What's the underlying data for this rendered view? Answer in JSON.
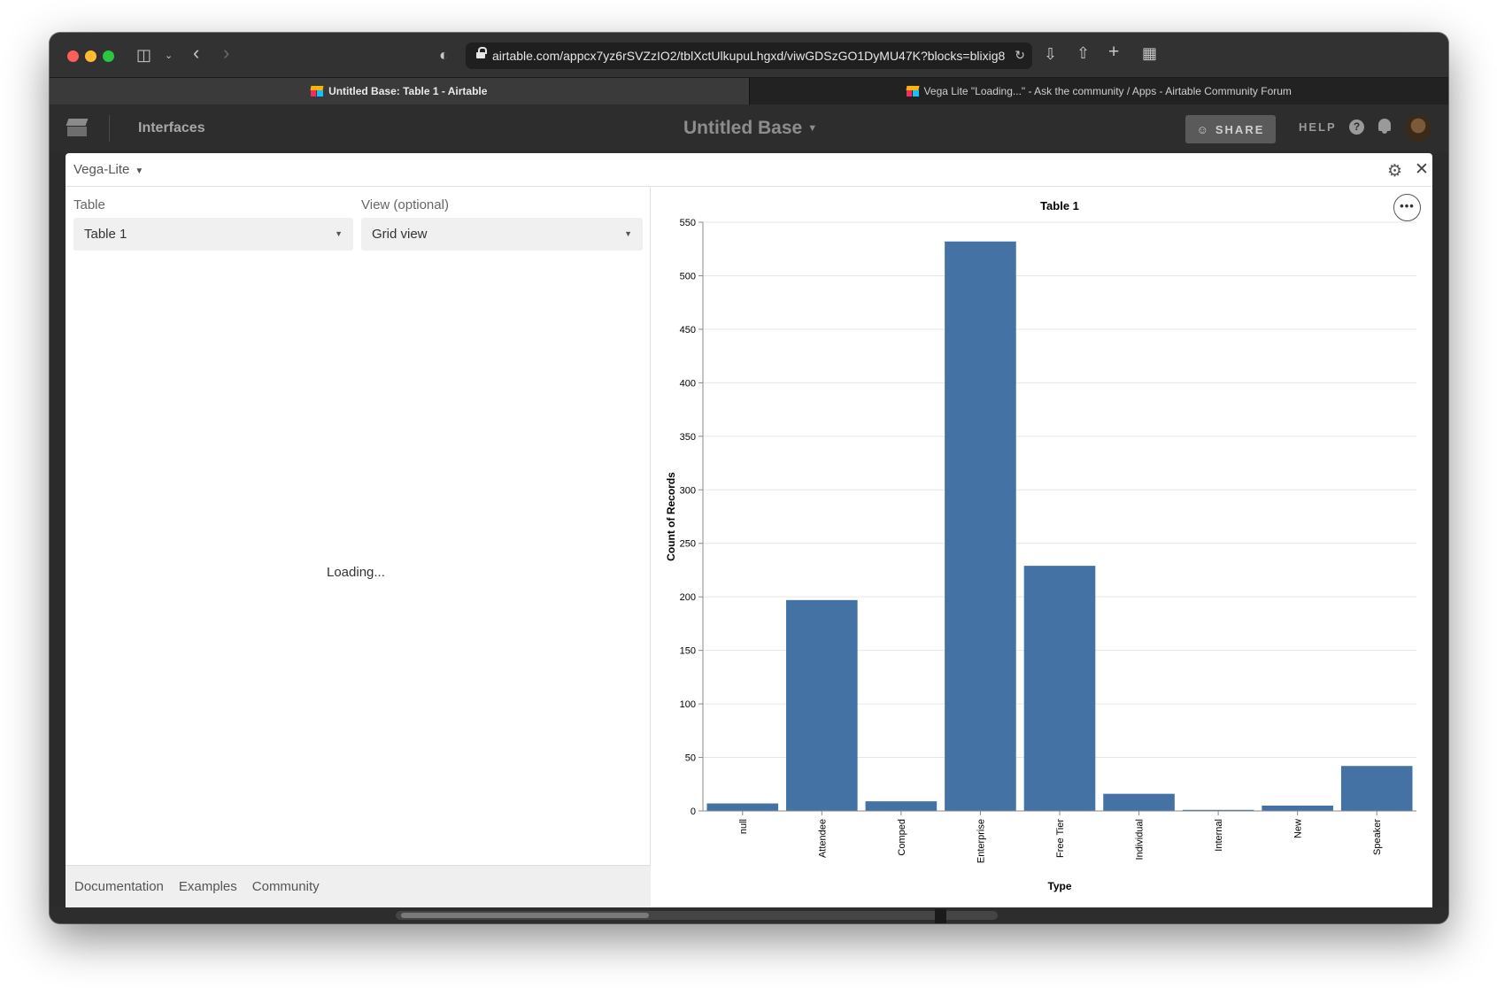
{
  "browser": {
    "url": "airtable.com/appcx7yz6rSVZzIO2/tblXctUlkupuLhgxd/viwGDSzGO1DyMU47K?blocks=blixig8",
    "tabs": [
      {
        "title": "Untitled Base: Table 1 - Airtable",
        "active": true
      },
      {
        "title": "Vega Lite \"Loading...\" - Ask the community / Apps - Airtable Community Forum",
        "active": false
      }
    ]
  },
  "app_header": {
    "interfaces_label": "Interfaces",
    "base_name": "Untitled Base",
    "share_label": "SHARE",
    "help_label": "HELP",
    "help_icon_glyph": "?"
  },
  "extension": {
    "title": "Vega-Lite",
    "table_label": "Table",
    "table_value": "Table 1",
    "view_label": "View (optional)",
    "view_value": "Grid view",
    "loading_text": "Loading...",
    "footer_links": [
      "Documentation",
      "Examples",
      "Community"
    ]
  },
  "colors": {
    "bar": "#4472a4",
    "grid": "#e6e6e6",
    "axis": "#888888"
  },
  "chart_data": {
    "type": "bar",
    "title": "Table 1",
    "xlabel": "Type",
    "ylabel": "Count of Records",
    "categories": [
      "null",
      "Attendee",
      "Comped",
      "Enterprise",
      "Free Tier",
      "Individual",
      "Internal",
      "New",
      "Speaker"
    ],
    "values": [
      7,
      197,
      9,
      532,
      229,
      16,
      1,
      5,
      42
    ],
    "ylim": [
      0,
      550
    ],
    "yticks": [
      0,
      50,
      100,
      150,
      200,
      250,
      300,
      350,
      400,
      450,
      500,
      550
    ],
    "grid": true
  }
}
